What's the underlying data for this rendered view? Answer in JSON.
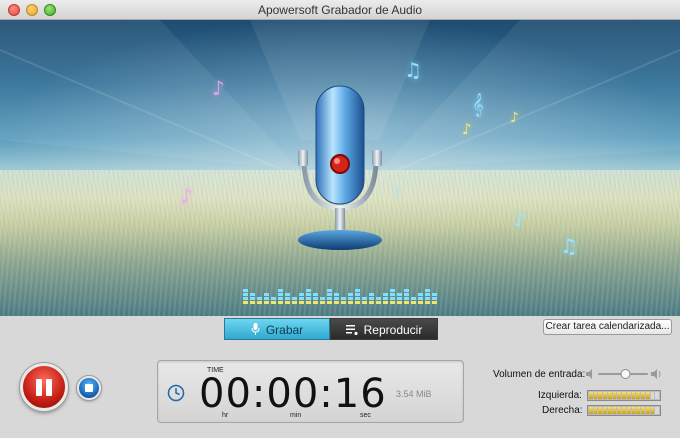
{
  "window": {
    "title": "Apowersoft Grabador de Audio"
  },
  "tabs": {
    "record": "Grabar",
    "playback": "Reproducir"
  },
  "schedule_button": "Crear tarea calendarizada...",
  "timer": {
    "label": "TIME",
    "value": "00:00:16",
    "unit_hr": "hr",
    "unit_min": "min",
    "unit_sec": "sec",
    "file_size": "3.54 MiB"
  },
  "input": {
    "volume_label": "Volumen de entrada:",
    "left_label": "Izquierda:",
    "right_label": "Derecha:",
    "volume_level": 0.55,
    "left_level": 0.87,
    "right_level": 0.93
  },
  "colors": {
    "accent": "#2fa8cf",
    "record": "#c41d14",
    "stop": "#1565b5",
    "meter": "#e3c24a"
  },
  "icons": [
    "close-icon",
    "minimize-icon",
    "zoom-icon",
    "microphone-icon",
    "playlist-icon",
    "pause-icon",
    "stop-icon",
    "clock-icon",
    "speaker-low-icon",
    "speaker-high-icon",
    "music-note-icon"
  ]
}
